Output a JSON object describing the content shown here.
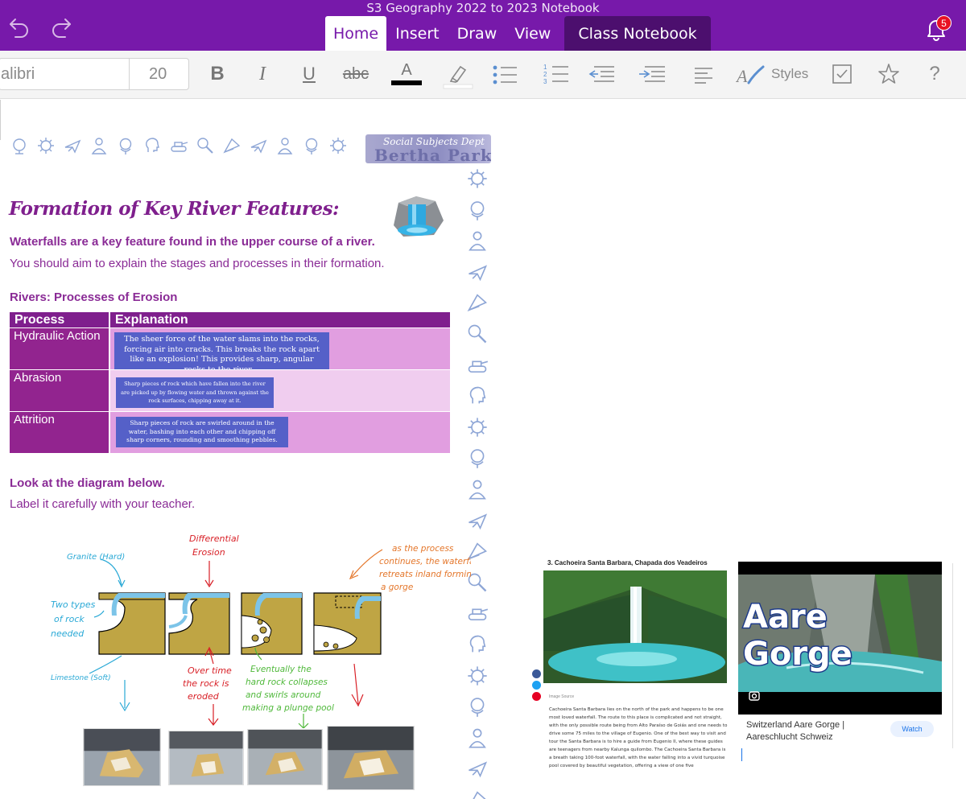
{
  "window": {
    "title": "S3 Geography 2022 to 2023 Notebook"
  },
  "tabs": [
    {
      "label": "Home",
      "active": true
    },
    {
      "label": "Insert",
      "active": false
    },
    {
      "label": "Draw",
      "active": false
    },
    {
      "label": "View",
      "active": false
    },
    {
      "label": "Class Notebook",
      "active": false
    }
  ],
  "notifications": {
    "count": "5"
  },
  "ribbon": {
    "font_name": "alibri",
    "font_size": "20",
    "bold": "B",
    "italic": "I",
    "underline": "U",
    "strikethrough": "abc",
    "font_color_letter": "A",
    "styles_label": "Styles",
    "help": "?"
  },
  "page": {
    "dept_banner_top": "Social Subjects Dept",
    "dept_banner_bottom": "Bertha Park",
    "heading": "Formation of Key River Features:",
    "intro_bold": "Waterfalls are a key feature found in the upper course of a river.",
    "intro_text": "You should aim to explain the stages and processes in their formation.",
    "section_title": "Rivers: Processes of Erosion",
    "table": {
      "headers": [
        "Process",
        "Explanation"
      ],
      "rows": [
        {
          "process": "Hydraulic Action",
          "explanation": "The sheer force of the water slams into the rocks, forcing air into cracks. This breaks the rock apart like an explosion! This provides sharp, angular rocks to the river…"
        },
        {
          "process": "Abrasion",
          "explanation": "Sharp pieces of rock which have fallen into the river are picked up by flowing water and thrown against the rock surfaces, chipping away at it."
        },
        {
          "process": "Attrition",
          "explanation": "Sharp pieces of rock are swirled around in the water, bashing into each other and chipping off sharp corners, rounding and smoothing pebbles."
        }
      ]
    },
    "diagram_prompt_bold": "Look at the diagram below.",
    "diagram_prompt_text": "Label it carefully with your teacher.",
    "diagram_labels": {
      "granite": "Granite (Hard)",
      "differential_1": "Differential",
      "differential_2": "Erosion",
      "process_1": "as the process",
      "process_2": "continues, the waterfall",
      "process_3": "retreats inland forming",
      "process_4": "a gorge",
      "two_types_1": "Two types",
      "two_types_2": "of rock",
      "two_types_3": "needed",
      "limestone": "Limestone (Soft)",
      "overtime_1": "Over time",
      "overtime_2": "the rock is",
      "overtime_3": "eroded",
      "eventually_1": "Eventually the",
      "eventually_2": "hard rock collapses",
      "eventually_3": "and swirls around",
      "eventually_4": "making a plunge pool"
    }
  },
  "clipping_1": {
    "title": "3. Cachoeira Santa Barbara, Chapada dos Veadeiros",
    "image_source": "Image Source",
    "body": "Cachoeira Santa Barbara lies on the north of the park and happens to be one most loved waterfall. The route to this place is complicated and not straight, with the only possible route being from Alto Paraíso de Goiás and one needs to drive some 75 miles to the village of Eugenio. One of the best way to visit and tour the Santa Barbara is to hire a guide from Eugenio II, where these guides are teenagers from nearby Kalunga quilombo. The Cachoeira Santa Barbara is a breath taking 100-foot waterfall, with the water falling into a vivid turquoise pool covered by beautiful vegetation, offering a view of one five"
  },
  "clipping_2": {
    "overlay_line1": "Aare",
    "overlay_line2": "Gorge",
    "caption": "Switzerland Aare Gorge | Aareschlucht Schweiz",
    "watch_label": "Watch"
  },
  "colors": {
    "title_bar": "#7719aa",
    "dark_tab": "#4c0f6e",
    "heading_purple": "#7f1f8d",
    "table_header": "#7f1f8d",
    "explanation_box": "#5560c8",
    "badge": "#e81123"
  }
}
